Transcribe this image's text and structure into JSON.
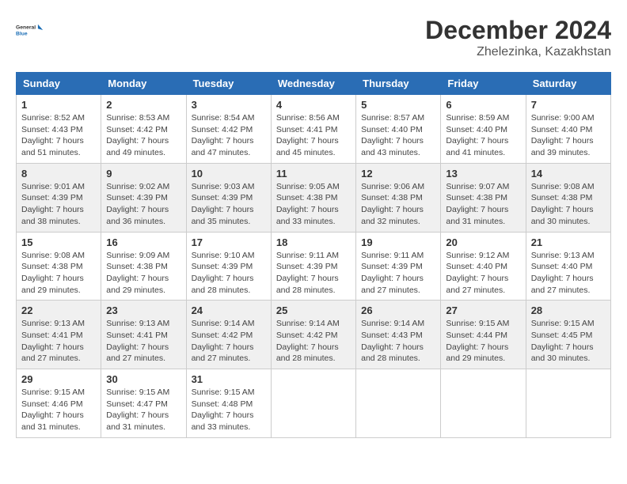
{
  "header": {
    "logo_line1": "General",
    "logo_line2": "Blue",
    "month_year": "December 2024",
    "location": "Zhelezinka, Kazakhstan"
  },
  "days_of_week": [
    "Sunday",
    "Monday",
    "Tuesday",
    "Wednesday",
    "Thursday",
    "Friday",
    "Saturday"
  ],
  "weeks": [
    [
      {
        "day": "1",
        "sunrise": "Sunrise: 8:52 AM",
        "sunset": "Sunset: 4:43 PM",
        "daylight": "Daylight: 7 hours and 51 minutes."
      },
      {
        "day": "2",
        "sunrise": "Sunrise: 8:53 AM",
        "sunset": "Sunset: 4:42 PM",
        "daylight": "Daylight: 7 hours and 49 minutes."
      },
      {
        "day": "3",
        "sunrise": "Sunrise: 8:54 AM",
        "sunset": "Sunset: 4:42 PM",
        "daylight": "Daylight: 7 hours and 47 minutes."
      },
      {
        "day": "4",
        "sunrise": "Sunrise: 8:56 AM",
        "sunset": "Sunset: 4:41 PM",
        "daylight": "Daylight: 7 hours and 45 minutes."
      },
      {
        "day": "5",
        "sunrise": "Sunrise: 8:57 AM",
        "sunset": "Sunset: 4:40 PM",
        "daylight": "Daylight: 7 hours and 43 minutes."
      },
      {
        "day": "6",
        "sunrise": "Sunrise: 8:59 AM",
        "sunset": "Sunset: 4:40 PM",
        "daylight": "Daylight: 7 hours and 41 minutes."
      },
      {
        "day": "7",
        "sunrise": "Sunrise: 9:00 AM",
        "sunset": "Sunset: 4:40 PM",
        "daylight": "Daylight: 7 hours and 39 minutes."
      }
    ],
    [
      {
        "day": "8",
        "sunrise": "Sunrise: 9:01 AM",
        "sunset": "Sunset: 4:39 PM",
        "daylight": "Daylight: 7 hours and 38 minutes."
      },
      {
        "day": "9",
        "sunrise": "Sunrise: 9:02 AM",
        "sunset": "Sunset: 4:39 PM",
        "daylight": "Daylight: 7 hours and 36 minutes."
      },
      {
        "day": "10",
        "sunrise": "Sunrise: 9:03 AM",
        "sunset": "Sunset: 4:39 PM",
        "daylight": "Daylight: 7 hours and 35 minutes."
      },
      {
        "day": "11",
        "sunrise": "Sunrise: 9:05 AM",
        "sunset": "Sunset: 4:38 PM",
        "daylight": "Daylight: 7 hours and 33 minutes."
      },
      {
        "day": "12",
        "sunrise": "Sunrise: 9:06 AM",
        "sunset": "Sunset: 4:38 PM",
        "daylight": "Daylight: 7 hours and 32 minutes."
      },
      {
        "day": "13",
        "sunrise": "Sunrise: 9:07 AM",
        "sunset": "Sunset: 4:38 PM",
        "daylight": "Daylight: 7 hours and 31 minutes."
      },
      {
        "day": "14",
        "sunrise": "Sunrise: 9:08 AM",
        "sunset": "Sunset: 4:38 PM",
        "daylight": "Daylight: 7 hours and 30 minutes."
      }
    ],
    [
      {
        "day": "15",
        "sunrise": "Sunrise: 9:08 AM",
        "sunset": "Sunset: 4:38 PM",
        "daylight": "Daylight: 7 hours and 29 minutes."
      },
      {
        "day": "16",
        "sunrise": "Sunrise: 9:09 AM",
        "sunset": "Sunset: 4:38 PM",
        "daylight": "Daylight: 7 hours and 29 minutes."
      },
      {
        "day": "17",
        "sunrise": "Sunrise: 9:10 AM",
        "sunset": "Sunset: 4:39 PM",
        "daylight": "Daylight: 7 hours and 28 minutes."
      },
      {
        "day": "18",
        "sunrise": "Sunrise: 9:11 AM",
        "sunset": "Sunset: 4:39 PM",
        "daylight": "Daylight: 7 hours and 28 minutes."
      },
      {
        "day": "19",
        "sunrise": "Sunrise: 9:11 AM",
        "sunset": "Sunset: 4:39 PM",
        "daylight": "Daylight: 7 hours and 27 minutes."
      },
      {
        "day": "20",
        "sunrise": "Sunrise: 9:12 AM",
        "sunset": "Sunset: 4:40 PM",
        "daylight": "Daylight: 7 hours and 27 minutes."
      },
      {
        "day": "21",
        "sunrise": "Sunrise: 9:13 AM",
        "sunset": "Sunset: 4:40 PM",
        "daylight": "Daylight: 7 hours and 27 minutes."
      }
    ],
    [
      {
        "day": "22",
        "sunrise": "Sunrise: 9:13 AM",
        "sunset": "Sunset: 4:41 PM",
        "daylight": "Daylight: 7 hours and 27 minutes."
      },
      {
        "day": "23",
        "sunrise": "Sunrise: 9:13 AM",
        "sunset": "Sunset: 4:41 PM",
        "daylight": "Daylight: 7 hours and 27 minutes."
      },
      {
        "day": "24",
        "sunrise": "Sunrise: 9:14 AM",
        "sunset": "Sunset: 4:42 PM",
        "daylight": "Daylight: 7 hours and 27 minutes."
      },
      {
        "day": "25",
        "sunrise": "Sunrise: 9:14 AM",
        "sunset": "Sunset: 4:42 PM",
        "daylight": "Daylight: 7 hours and 28 minutes."
      },
      {
        "day": "26",
        "sunrise": "Sunrise: 9:14 AM",
        "sunset": "Sunset: 4:43 PM",
        "daylight": "Daylight: 7 hours and 28 minutes."
      },
      {
        "day": "27",
        "sunrise": "Sunrise: 9:15 AM",
        "sunset": "Sunset: 4:44 PM",
        "daylight": "Daylight: 7 hours and 29 minutes."
      },
      {
        "day": "28",
        "sunrise": "Sunrise: 9:15 AM",
        "sunset": "Sunset: 4:45 PM",
        "daylight": "Daylight: 7 hours and 30 minutes."
      }
    ],
    [
      {
        "day": "29",
        "sunrise": "Sunrise: 9:15 AM",
        "sunset": "Sunset: 4:46 PM",
        "daylight": "Daylight: 7 hours and 31 minutes."
      },
      {
        "day": "30",
        "sunrise": "Sunrise: 9:15 AM",
        "sunset": "Sunset: 4:47 PM",
        "daylight": "Daylight: 7 hours and 31 minutes."
      },
      {
        "day": "31",
        "sunrise": "Sunrise: 9:15 AM",
        "sunset": "Sunset: 4:48 PM",
        "daylight": "Daylight: 7 hours and 33 minutes."
      },
      null,
      null,
      null,
      null
    ]
  ]
}
